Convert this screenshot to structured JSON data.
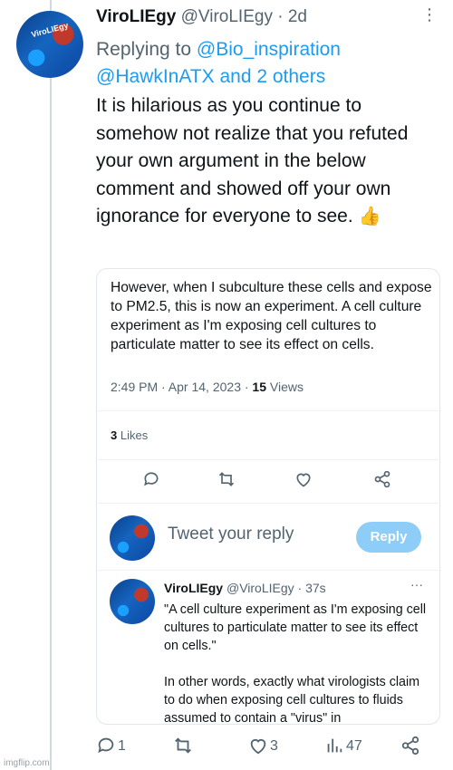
{
  "tweet": {
    "display_name": "ViroLIEgy",
    "handle": "@ViroLIEgy",
    "time": "· 2d",
    "more": "⋮",
    "replying_prefix": "Replying to ",
    "replying_user1": "@Bio_inspiration",
    "replying_user2": "@HawkInATX and 2 others",
    "body": "It is hilarious as you continue to somehow not realize that you refuted your own argument in the below comment and showed off your own ignorance for everyone to see.",
    "emoji": "👍",
    "avatar_text": "ViroLIEgy"
  },
  "embedded": {
    "text": "However, when I subculture these cells and expose to PM2.5, this is now an experiment. A cell culture experiment as I'm exposing cell cultures to particulate matter to see its effect on cells.",
    "time": "2:49 PM · Apr 14, 2023 · ",
    "views_count": "15",
    "views_label": " Views",
    "likes_count": "3",
    "likes_label": " Likes",
    "reply_placeholder": "Tweet your reply",
    "reply_button": "Reply",
    "sub_display_name": "ViroLIEgy",
    "sub_handle": "@ViroLIEgy · 37s",
    "sub_more": "···",
    "sub_text_1": "\"A cell culture experiment as I'm exposing cell cultures to particulate matter to see its effect on cells.\"",
    "sub_text_2": "In other words, exactly what virologists claim to do when exposing cell cultures to fluids assumed to contain a \"virus\" in"
  },
  "actions": {
    "reply_count": "1",
    "retweet_count": "",
    "like_count": "3",
    "views_count": "47"
  },
  "icons": [
    "more-icon",
    "reply-icon",
    "retweet-icon",
    "like-icon",
    "share-icon",
    "views-icon"
  ],
  "colors": {
    "link": "#1d9bf0",
    "muted": "#536471",
    "reply_button": "#8ecdf8"
  },
  "watermark": "imgflip.com"
}
